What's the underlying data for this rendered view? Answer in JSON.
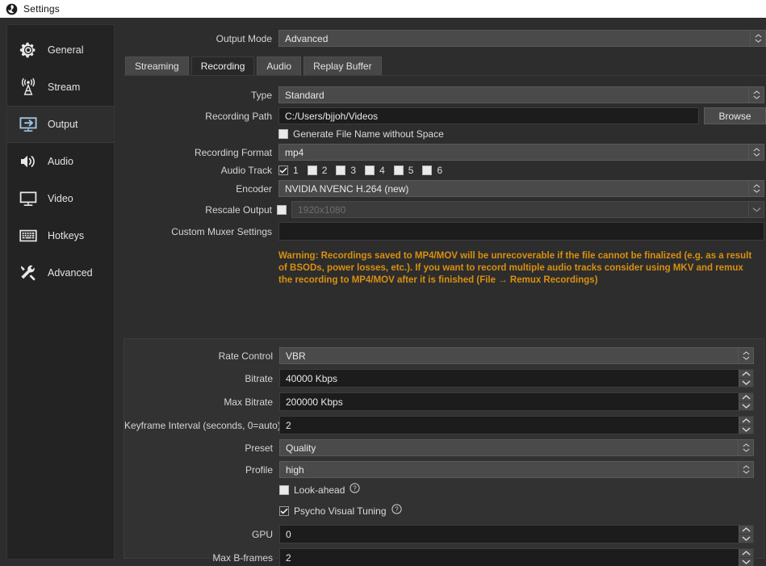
{
  "window": {
    "title": "Settings",
    "icon": "obs-logo-icon"
  },
  "sidebar": {
    "items": [
      {
        "label": "General",
        "icon": "gear-icon",
        "selected": false
      },
      {
        "label": "Stream",
        "icon": "broadcast-icon",
        "selected": false
      },
      {
        "label": "Output",
        "icon": "monitor-arrow-icon",
        "selected": true
      },
      {
        "label": "Audio",
        "icon": "speaker-icon",
        "selected": false
      },
      {
        "label": "Video",
        "icon": "monitor-icon",
        "selected": false
      },
      {
        "label": "Hotkeys",
        "icon": "keyboard-icon",
        "selected": false
      },
      {
        "label": "Advanced",
        "icon": "tools-icon",
        "selected": false
      }
    ]
  },
  "output_mode": {
    "label": "Output Mode",
    "value": "Advanced"
  },
  "tabs": [
    {
      "label": "Streaming",
      "active": false
    },
    {
      "label": "Recording",
      "active": true
    },
    {
      "label": "Audio",
      "active": false
    },
    {
      "label": "Replay Buffer",
      "active": false
    }
  ],
  "recording": {
    "type": {
      "label": "Type",
      "value": "Standard"
    },
    "path": {
      "label": "Recording Path",
      "value": "C:/Users/bjjoh/Videos",
      "browse_label": "Browse"
    },
    "generate_no_space": {
      "label": "Generate File Name without Space",
      "checked": false
    },
    "format": {
      "label": "Recording Format",
      "value": "mp4"
    },
    "audio_track": {
      "label": "Audio Track",
      "tracks": [
        {
          "number": "1",
          "checked": true
        },
        {
          "number": "2",
          "checked": false
        },
        {
          "number": "3",
          "checked": false
        },
        {
          "number": "4",
          "checked": false
        },
        {
          "number": "5",
          "checked": false
        },
        {
          "number": "6",
          "checked": false
        }
      ]
    },
    "encoder": {
      "label": "Encoder",
      "value": "NVIDIA NVENC H.264 (new)"
    },
    "rescale": {
      "label": "Rescale Output",
      "checked": false,
      "value": "1920x1080",
      "disabled": true
    },
    "muxer": {
      "label": "Custom Muxer Settings",
      "value": ""
    },
    "warning": "Warning: Recordings saved to MP4/MOV will be unrecoverable if the file cannot be finalized (e.g. as a result of BSODs, power losses, etc.). If you want to record multiple audio tracks consider using MKV and remux the recording to MP4/MOV after it is finished (File → Remux Recordings)"
  },
  "encoder_settings": {
    "rate_control": {
      "label": "Rate Control",
      "value": "VBR"
    },
    "bitrate": {
      "label": "Bitrate",
      "value": "40000 Kbps"
    },
    "max_bitrate": {
      "label": "Max Bitrate",
      "value": "200000 Kbps"
    },
    "keyframe_interval": {
      "label": "Keyframe Interval (seconds, 0=auto)",
      "value": "2"
    },
    "preset": {
      "label": "Preset",
      "value": "Quality"
    },
    "profile": {
      "label": "Profile",
      "value": "high"
    },
    "look_ahead": {
      "label": "Look-ahead",
      "checked": false
    },
    "psycho_visual": {
      "label": "Psycho Visual Tuning",
      "checked": true
    },
    "gpu": {
      "label": "GPU",
      "value": "0"
    },
    "max_b_frames": {
      "label": "Max B-frames",
      "value": "2"
    }
  },
  "colors": {
    "warning": "#d9900f",
    "panel_bg": "#2d2d2d",
    "sidebar_bg": "#232323",
    "field_bg": "#1c1c1c",
    "combo_bg": "#4a4a4a",
    "accent_icon": "#9fc2dd"
  }
}
